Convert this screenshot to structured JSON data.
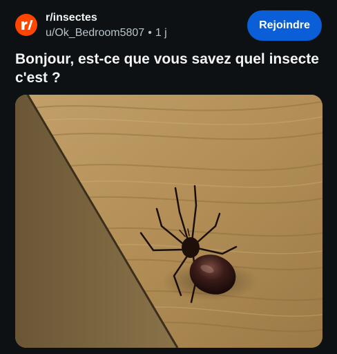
{
  "post": {
    "subreddit": {
      "name": "r/insectes",
      "icon": "reddit-community-icon",
      "icon_color": "#ff4500"
    },
    "author": "u/Ok_Bedroom5807",
    "separator": "•",
    "age": "1 j",
    "join_button": {
      "label": "Rejoindre",
      "color": "#0a5fd8"
    },
    "title": "Bonjour, est-ce que vous savez quel insecte c'est ?",
    "image": {
      "subject": "spider on wooden floor",
      "floor_color": "#b9955b",
      "skirting_color": "#7d6842"
    }
  },
  "theme": {
    "background": "#0e1113",
    "text_primary": "#f2f4f5",
    "text_secondary": "#b7c4cb"
  }
}
